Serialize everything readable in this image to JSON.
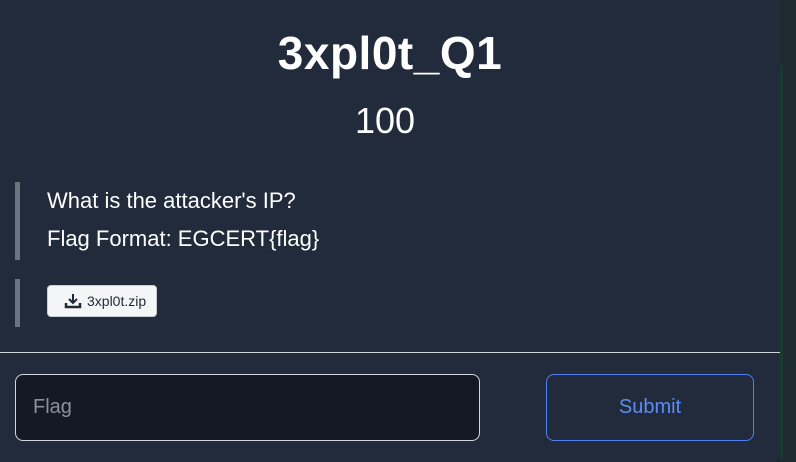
{
  "challenge": {
    "title": "3xpl0t_Q1",
    "points": "100"
  },
  "description": {
    "lines": [
      "What is the attacker's IP?",
      "Flag Format: EGCERT{flag}"
    ]
  },
  "files": [
    {
      "name": "3xpl0t.zip",
      "icon": "download-icon"
    }
  ],
  "form": {
    "flag_placeholder": "Flag",
    "flag_value": "",
    "submit_label": "Submit"
  },
  "colors": {
    "background": "#212b3b",
    "accent": "#4f80f0",
    "border_bar": "#6b7280"
  }
}
